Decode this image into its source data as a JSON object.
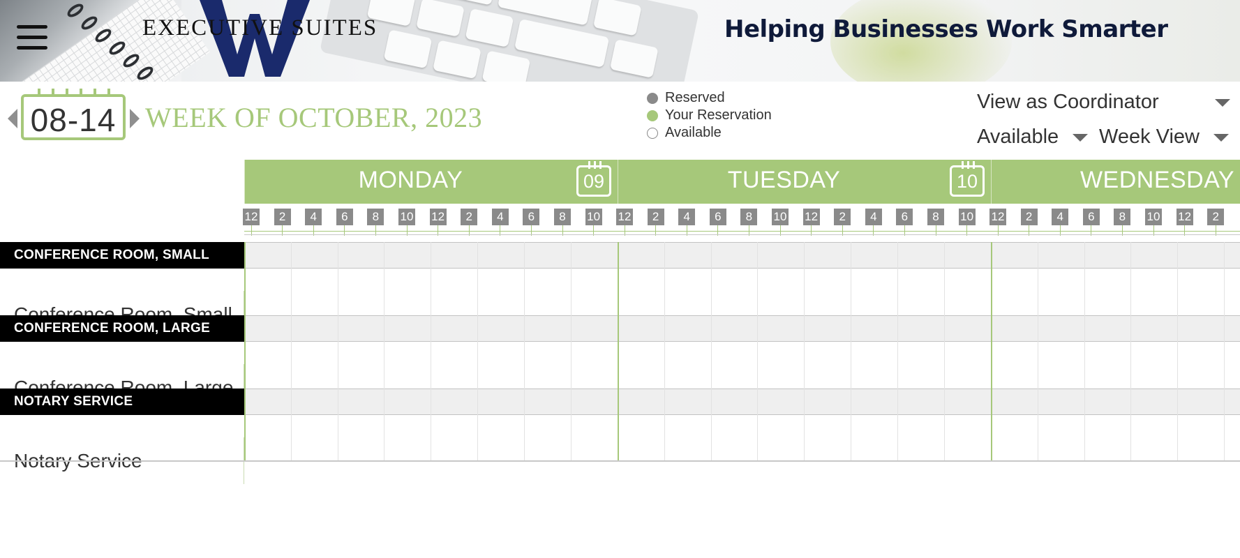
{
  "header": {
    "logo_text": "EXECUTIVE SUITES",
    "tagline": "Helping Businesses Work Smarter",
    "brand_color": "#1a2a6c",
    "menu_icon": "hamburger-menu-icon"
  },
  "toolbar": {
    "date_range": "08-14",
    "week_title": "WEEK OF OCTOBER, 2023",
    "prev_icon": "caret-left-icon",
    "next_icon": "caret-right-icon",
    "view_as": "View as Coordinator",
    "availability_filter": "Available",
    "view_mode": "Week View"
  },
  "legend": [
    {
      "label": "Reserved",
      "color": "#8a8a8a"
    },
    {
      "label": "Your Reservation",
      "color": "#a6c87a"
    },
    {
      "label": "Available",
      "color": "#ffffff"
    }
  ],
  "days": [
    {
      "name": "MONDAY",
      "date": "09"
    },
    {
      "name": "TUESDAY",
      "date": "10"
    },
    {
      "name": "WEDNESDAY",
      "date": ""
    }
  ],
  "hour_labels": [
    "12",
    "2",
    "4",
    "6",
    "8",
    "10",
    "12",
    "2",
    "4",
    "6",
    "8",
    "10"
  ],
  "resources": [
    {
      "category": "CONFERENCE ROOM, SMALL",
      "name": "Conference Room, Small"
    },
    {
      "category": "CONFERENCE ROOM, LARGE",
      "name": "Conference Room, Large"
    },
    {
      "category": "NOTARY SERVICE",
      "name": "Notary Service"
    }
  ],
  "colors": {
    "accent": "#a6c87a",
    "label_bg": "#000000",
    "hour_badge": "#8a8a8a"
  }
}
